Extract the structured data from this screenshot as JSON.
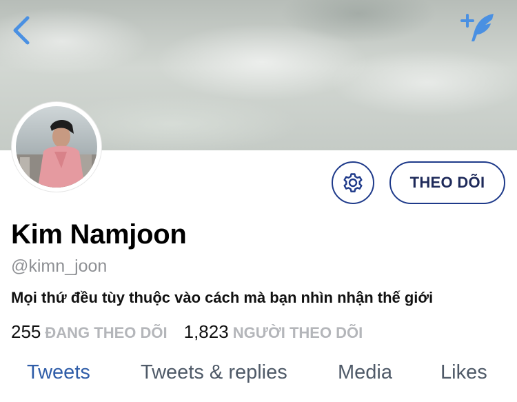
{
  "header": {
    "back_icon": "chevron-left-icon",
    "compose_icon": "compose-sparkle-feather-icon",
    "accent_color": "#4a90e2"
  },
  "profile": {
    "name": "Kim Namjoon",
    "handle": "@kimn_joon",
    "bio": "Mọi thứ đều tùy thuộc vào cách mà bạn nhìn nhận thế giới",
    "follow_label": "THEO DÕI",
    "settings_icon": "gear-icon"
  },
  "stats": {
    "following_count": "255",
    "following_label": "ĐANG THEO DÕI",
    "followers_count": "1,823",
    "followers_label": "NGƯỜI THEO DÕI"
  },
  "tabs": [
    {
      "label": "Tweets",
      "active": true
    },
    {
      "label": "Tweets & replies",
      "active": false
    },
    {
      "label": "Media",
      "active": false
    },
    {
      "label": "Likes",
      "active": false
    }
  ],
  "colors": {
    "button_border": "#1e3a8a",
    "active_tab": "#2f5da8",
    "inactive_tab": "#4f5a68",
    "muted_text": "#8e9094"
  }
}
